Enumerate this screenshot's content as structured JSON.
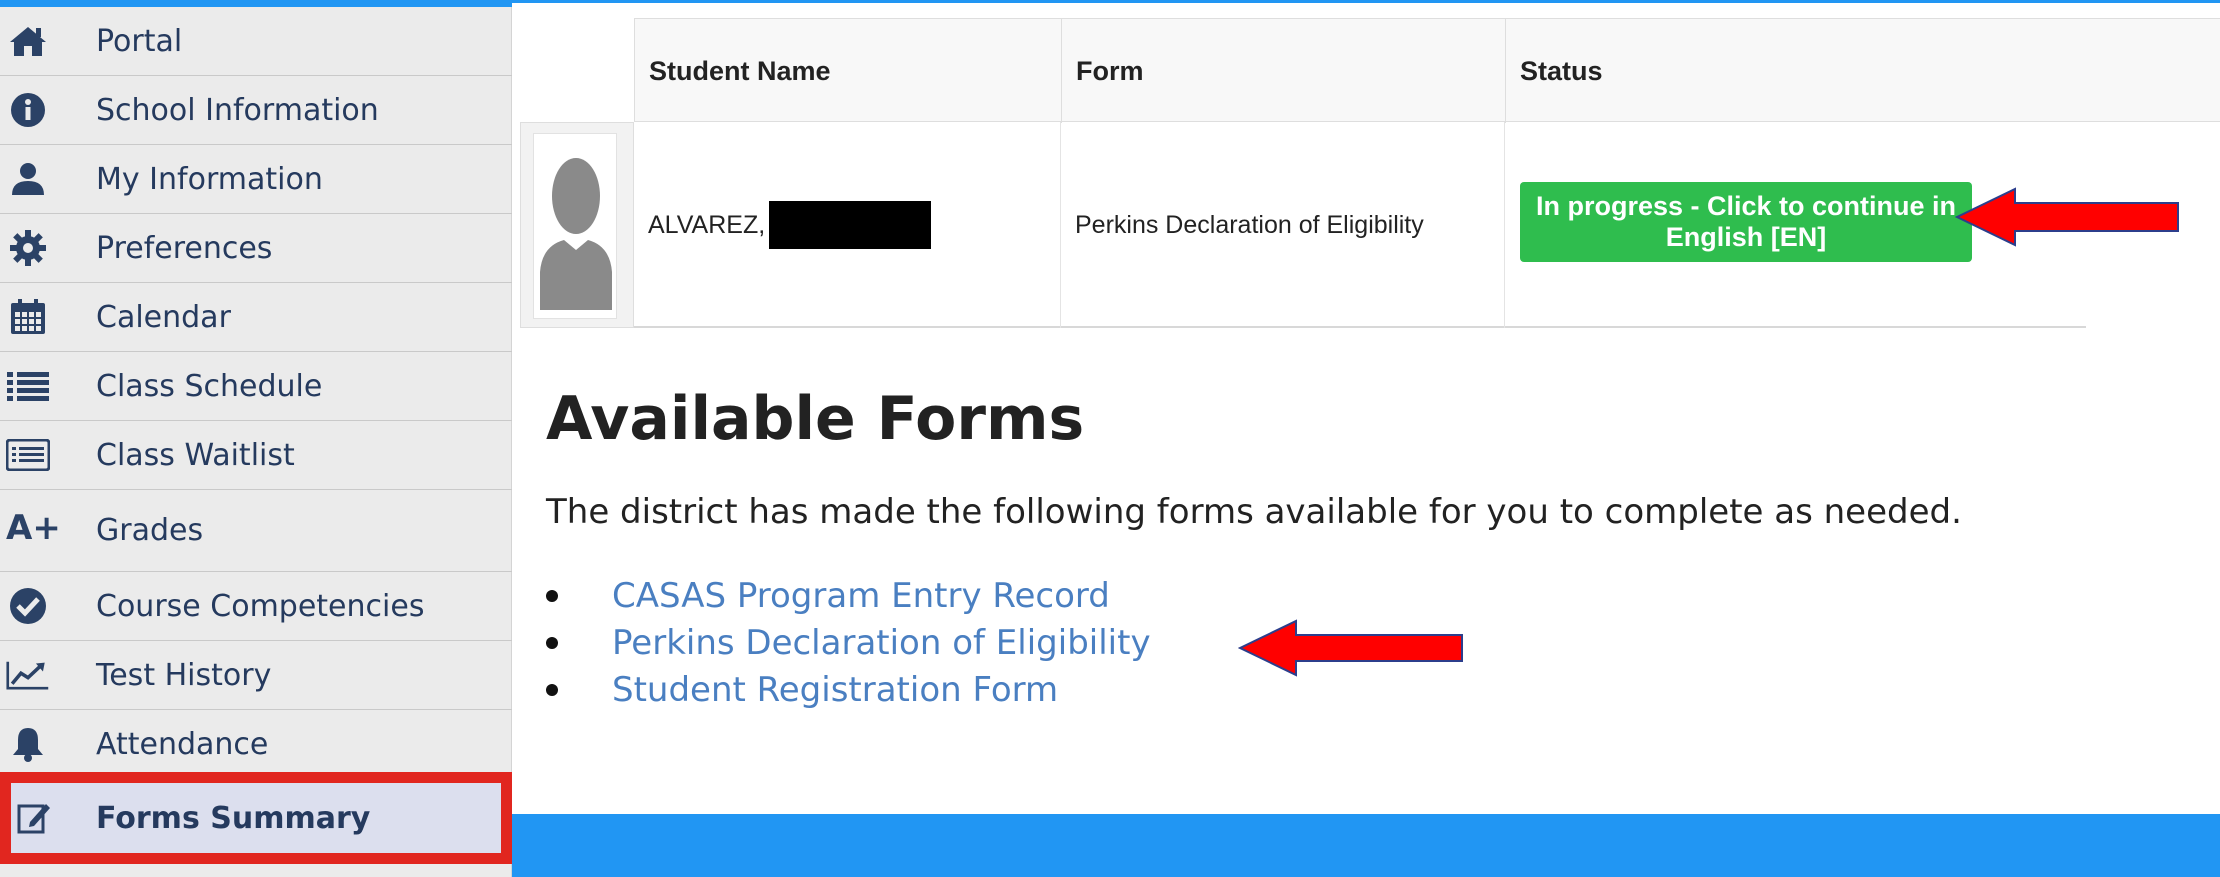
{
  "sidebar": {
    "items": [
      {
        "label": "Portal",
        "icon": "home-icon"
      },
      {
        "label": "School Information",
        "icon": "info-icon"
      },
      {
        "label": "My Information",
        "icon": "user-icon"
      },
      {
        "label": "Preferences",
        "icon": "gear-icon"
      },
      {
        "label": "Calendar",
        "icon": "calendar-icon"
      },
      {
        "label": "Class Schedule",
        "icon": "list-icon"
      },
      {
        "label": "Class Waitlist",
        "icon": "waitlist-icon"
      },
      {
        "label": "Grades",
        "icon": "grades-icon",
        "icon_text": "A+"
      },
      {
        "label": "Course Competencies",
        "icon": "check-circle-icon"
      },
      {
        "label": "Test History",
        "icon": "line-chart-icon"
      },
      {
        "label": "Attendance",
        "icon": "bell-icon"
      },
      {
        "label": "Forms Summary",
        "icon": "edit-icon",
        "active": true
      }
    ]
  },
  "table": {
    "headers": [
      "Student Name",
      "Form",
      "Status"
    ],
    "rows": [
      {
        "student_name": "ALVAREZ,",
        "form": "Perkins Declaration of Eligibility",
        "status_button": "In progress - Click to continue in English [EN]"
      }
    ]
  },
  "available_forms": {
    "title": "Available Forms",
    "description": "The district has made the following forms available for you to complete as needed.",
    "links": [
      "CASAS Program Entry Record",
      "Perkins Declaration of Eligibility",
      "Student Registration Form"
    ]
  },
  "colors": {
    "accent_blue": "#2196f3",
    "sidebar_text": "#253a5e",
    "link": "#4a7fc1",
    "button_green": "#2fbd4e",
    "highlight_red": "#e1261f",
    "arrow_red": "#ff0000",
    "arrow_outline": "#2c3e8c"
  }
}
